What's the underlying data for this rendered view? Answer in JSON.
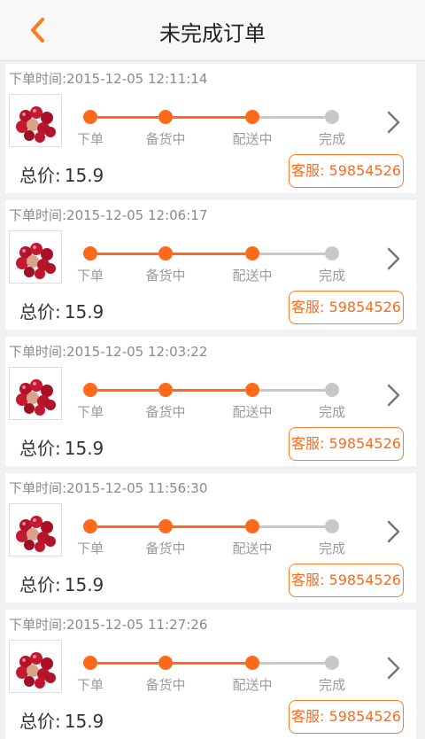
{
  "header": {
    "back_icon": "chevron-left-icon",
    "title": "未完成订单"
  },
  "colors": {
    "accent": "#ff6a1a",
    "inactive": "#c8c8c8"
  },
  "orders": [
    {
      "time_text": "下单时间:2015-12-05 12:11:14",
      "steps": [
        "下单",
        "备货中",
        "配送中",
        "完成"
      ],
      "completed_steps": 3,
      "total_label": "总价:",
      "total_value": "15.9",
      "service_text": "客服: 59854526"
    },
    {
      "time_text": "下单时间:2015-12-05 12:06:17",
      "steps": [
        "下单",
        "备货中",
        "配送中",
        "完成"
      ],
      "completed_steps": 3,
      "total_label": "总价:",
      "total_value": "15.9",
      "service_text": "客服: 59854526"
    },
    {
      "time_text": "下单时间:2015-12-05 12:03:22",
      "steps": [
        "下单",
        "备货中",
        "配送中",
        "完成"
      ],
      "completed_steps": 3,
      "total_label": "总价:",
      "total_value": "15.9",
      "service_text": "客服: 59854526"
    },
    {
      "time_text": "下单时间:2015-12-05 11:56:30",
      "steps": [
        "下单",
        "备货中",
        "配送中",
        "完成"
      ],
      "completed_steps": 3,
      "total_label": "总价:",
      "total_value": "15.9",
      "service_text": "客服: 59854526"
    },
    {
      "time_text": "下单时间:2015-12-05 11:27:26",
      "steps": [
        "下单",
        "备货中",
        "配送中",
        "完成"
      ],
      "completed_steps": 3,
      "total_label": "总价:",
      "total_value": "15.9",
      "service_text": "客服: 59854526"
    }
  ]
}
